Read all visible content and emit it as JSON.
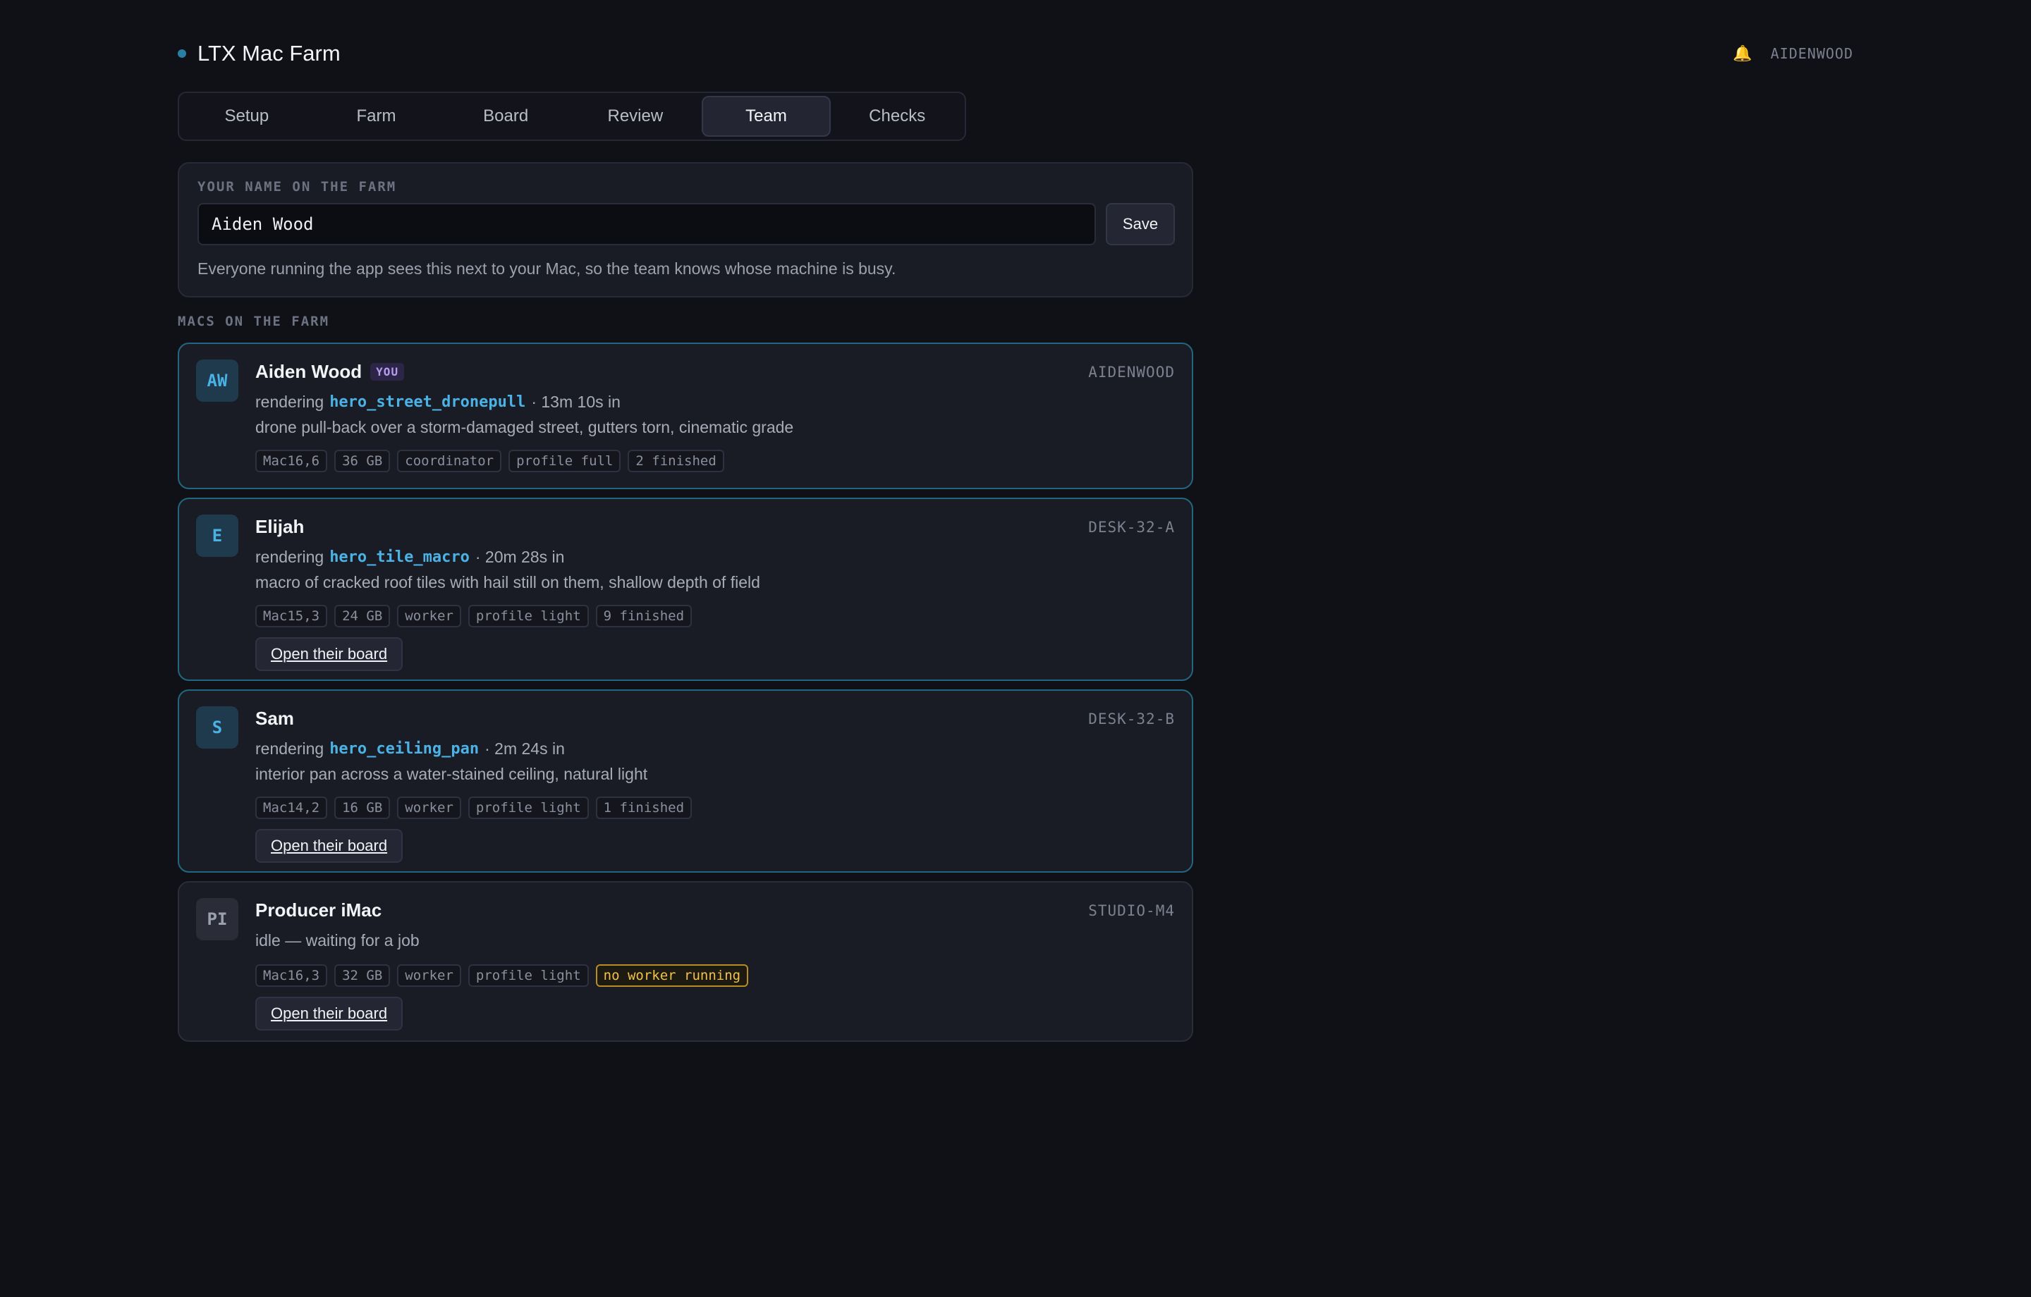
{
  "header": {
    "title": "LTX Mac Farm",
    "bell_icon": "🔔",
    "host": "AIDENWOOD"
  },
  "tabs": [
    {
      "label": "Setup",
      "active": false
    },
    {
      "label": "Farm",
      "active": false
    },
    {
      "label": "Board",
      "active": false
    },
    {
      "label": "Review",
      "active": false
    },
    {
      "label": "Team",
      "active": true
    },
    {
      "label": "Checks",
      "active": false
    }
  ],
  "name_panel": {
    "label": "YOUR NAME ON THE FARM",
    "value": "Aiden Wood",
    "save_label": "Save",
    "help": "Everyone running the app sees this next to your Mac, so the team knows whose machine is busy."
  },
  "macs_label": "MACS ON THE FARM",
  "board_button_label": "Open their board",
  "macs": [
    {
      "initials": "AW",
      "name": "Aiden Wood",
      "you_badge": "YOU",
      "host": "AIDENWOOD",
      "status_prefix": "rendering",
      "job": "hero_street_dronepull",
      "elapsed": "· 13m 10s in",
      "description": "drone pull-back over a storm-damaged street, gutters torn, cinematic grade",
      "chips": [
        "Mac16,6",
        "36 GB",
        "coordinator",
        "profile full",
        "2 finished"
      ]
    },
    {
      "initials": "E",
      "name": "Elijah",
      "host": "DESK-32-A",
      "status_prefix": "rendering",
      "job": "hero_tile_macro",
      "elapsed": "· 20m 28s in",
      "description": "macro of cracked roof tiles with hail still on them, shallow depth of field",
      "chips": [
        "Mac15,3",
        "24 GB",
        "worker",
        "profile light",
        "9 finished"
      ]
    },
    {
      "initials": "S",
      "name": "Sam",
      "host": "DESK-32-B",
      "status_prefix": "rendering",
      "job": "hero_ceiling_pan",
      "elapsed": "· 2m 24s in",
      "description": "interior pan across a water-stained ceiling, natural light",
      "chips": [
        "Mac14,2",
        "16 GB",
        "worker",
        "profile light",
        "1 finished"
      ]
    },
    {
      "initials": "PI",
      "name": "Producer iMac",
      "host": "STUDIO-M4",
      "status": "idle — waiting for a job",
      "chips": [
        "Mac16,3",
        "32 GB",
        "worker",
        "profile light"
      ],
      "warn_chip": "no worker running"
    }
  ],
  "colors": {
    "background": "#101117",
    "card": "#1a1c25",
    "accent": "#4bb2e6",
    "active_border": "#22677f",
    "warning": "#f2c14a"
  }
}
